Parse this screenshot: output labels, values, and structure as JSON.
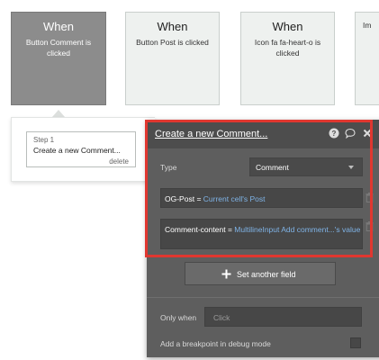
{
  "events": [
    {
      "title": "When",
      "description": "Button Comment is clicked",
      "active": true
    },
    {
      "title": "When",
      "description": "Button Post is clicked",
      "active": false
    },
    {
      "title": "When",
      "description": "Icon fa fa-heart-o is clicked",
      "active": false
    },
    {
      "title": "",
      "description": "Im",
      "active": false
    }
  ],
  "workflow": {
    "step_label": "Step 1",
    "step_title": "Create a new Comment...",
    "delete_label": "delete"
  },
  "panel": {
    "title": "Create a new Comment...",
    "header_icons": [
      "help-icon",
      "comment-icon",
      "close-icon"
    ],
    "type_label": "Type",
    "type_value": "Comment",
    "fields": [
      {
        "key": "OG-Post",
        "eq": "=",
        "value": "Current cell's Post"
      },
      {
        "key": "Comment-content",
        "eq": "=",
        "value": "MultilineInput Add comment...'s value"
      }
    ],
    "set_field_label": "Set another field",
    "only_when_label": "Only when",
    "only_when_placeholder": "Click",
    "breakpoint_label": "Add a breakpoint in debug mode"
  },
  "colors": {
    "highlight": "#e03730",
    "link_blue": "#7fb3e6",
    "panel_bg": "#5e5e5e",
    "active_card": "#8c8c8c"
  }
}
